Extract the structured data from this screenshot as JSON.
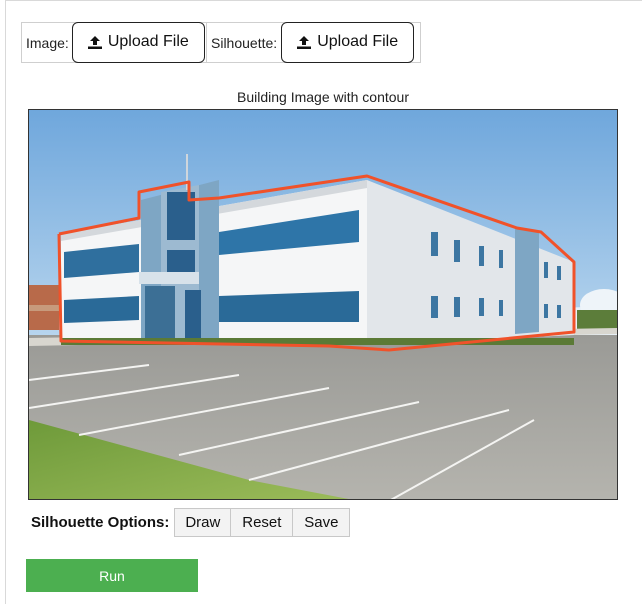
{
  "upload": {
    "image_label": "Image:",
    "image_button": "Upload File",
    "silhouette_label": "Silhouette:",
    "silhouette_button": "Upload File",
    "icon": "upload-icon"
  },
  "image_panel": {
    "title": "Building Image with contour"
  },
  "silhouette_options": {
    "label": "Silhouette Options:",
    "draw": "Draw",
    "reset": "Reset",
    "save": "Save"
  },
  "run_button": "Run",
  "colors": {
    "run": "#4caf50",
    "contour": "#f0522a"
  }
}
